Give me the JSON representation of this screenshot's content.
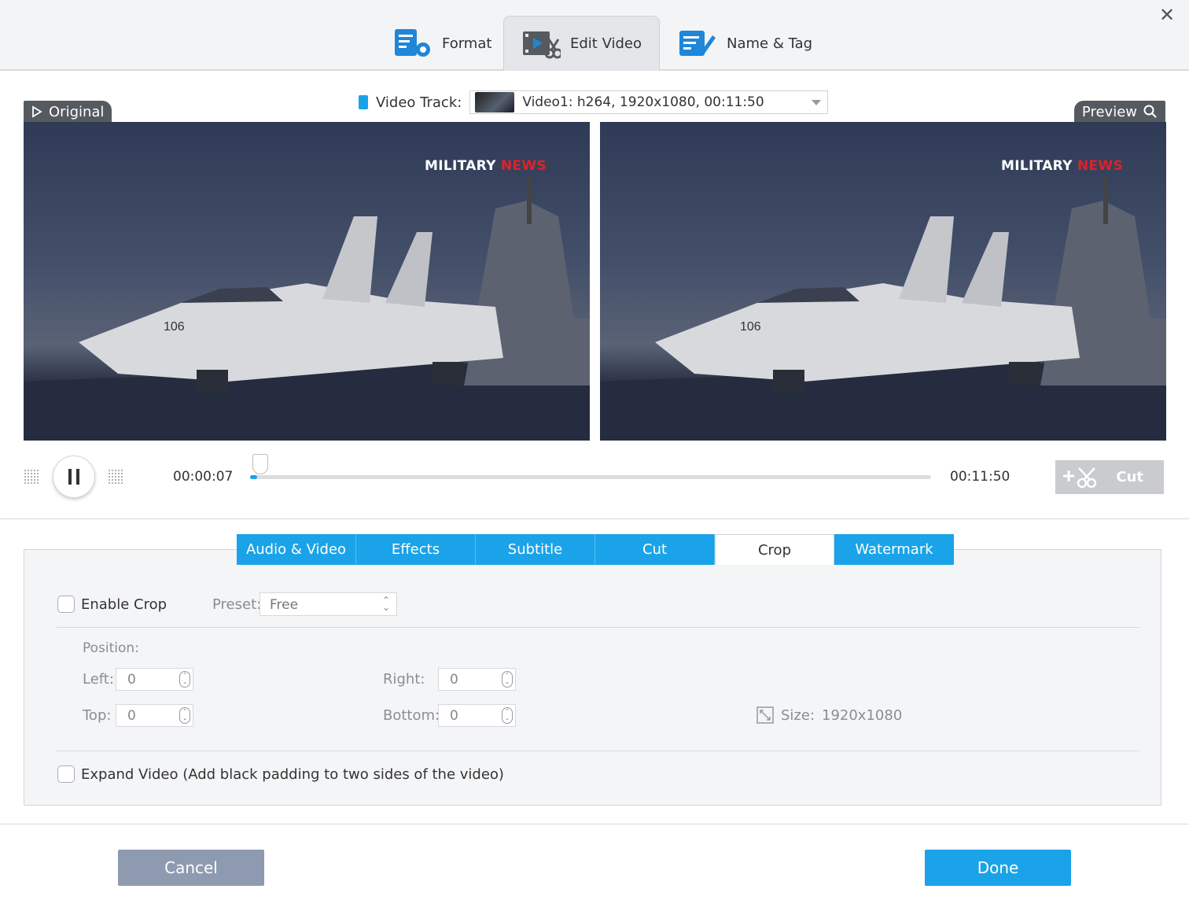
{
  "header": {
    "tabs": [
      {
        "label": "Format",
        "icon": "format-settings-icon"
      },
      {
        "label": "Edit Video",
        "icon": "edit-video-icon"
      },
      {
        "label": "Name & Tag",
        "icon": "name-tag-icon"
      }
    ],
    "active_tab": "Edit Video"
  },
  "video": {
    "original_label": "Original",
    "preview_label": "Preview",
    "track_label": "Video Track:",
    "track_value": "Video1: h264, 1920x1080, 00:11:50",
    "watermark_white": "MILITARY",
    "watermark_red": "NEWS",
    "jet_number": "106"
  },
  "playback": {
    "current_time": "00:00:07",
    "total_time": "00:11:50",
    "progress_fraction": 0.01,
    "cut_label": "Cut"
  },
  "edit_tabs": [
    "Audio & Video",
    "Effects",
    "Subtitle",
    "Cut",
    "Crop",
    "Watermark"
  ],
  "active_edit_tab": "Crop",
  "crop": {
    "enable_label": "Enable Crop",
    "enable_checked": false,
    "preset_label": "Preset:",
    "preset_value": "Free",
    "position_label": "Position:",
    "left_label": "Left:",
    "left_value": "0",
    "right_label": "Right:",
    "right_value": "0",
    "top_label": "Top:",
    "top_value": "0",
    "bottom_label": "Bottom:",
    "bottom_value": "0",
    "size_label": "Size:",
    "size_value": "1920x1080",
    "expand_label": "Expand Video (Add black padding to two sides of the video)",
    "expand_checked": false
  },
  "footer": {
    "cancel_label": "Cancel",
    "done_label": "Done"
  },
  "colors": {
    "accent": "#1aa3e8",
    "cancel": "#8e9ab0",
    "cut_disabled": "#c9cbce",
    "news_red": "#e0202a"
  }
}
